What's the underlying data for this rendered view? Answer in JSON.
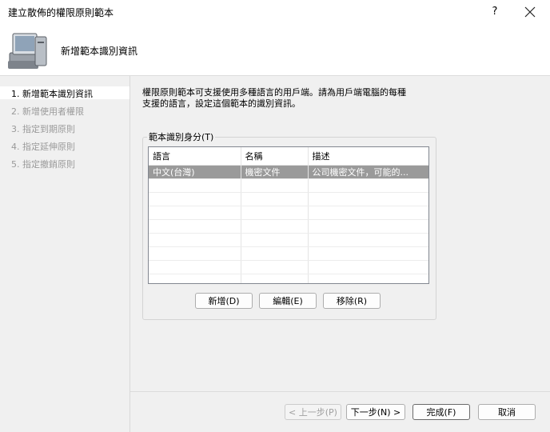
{
  "window": {
    "title": "建立散佈的權限原則範本",
    "help": "?",
    "close": "✕"
  },
  "header": {
    "title": "新增範本識別資訊",
    "icon": "computer-icon"
  },
  "nav": {
    "items": [
      {
        "label": "1. 新增範本識別資訊",
        "active": true
      },
      {
        "label": "2. 新增使用者權限",
        "active": false
      },
      {
        "label": "3. 指定到期原則",
        "active": false
      },
      {
        "label": "4. 指定延伸原則",
        "active": false
      },
      {
        "label": "5. 指定撤銷原則",
        "active": false
      }
    ]
  },
  "content": {
    "description_line1": "權限原則範本可支援使用多種語言的用戶端。請為用戶端電腦的每種",
    "description_line2": "支援的語言，設定這個範本的識別資訊。",
    "group_label": "範本識別身分(T)",
    "table": {
      "columns": [
        "語言",
        "名稱",
        "描述"
      ],
      "rows": [
        {
          "language": "中文(台灣)",
          "name": "機密文件",
          "description": "公司機密文件，可能的..."
        }
      ]
    },
    "buttons": {
      "add": "新增(D)",
      "edit": "編輯(E)",
      "remove": "移除(R)"
    }
  },
  "footer": {
    "back": "< 上一步(P)",
    "next": "下一步(N) >",
    "finish": "完成(F)",
    "cancel": "取消"
  }
}
